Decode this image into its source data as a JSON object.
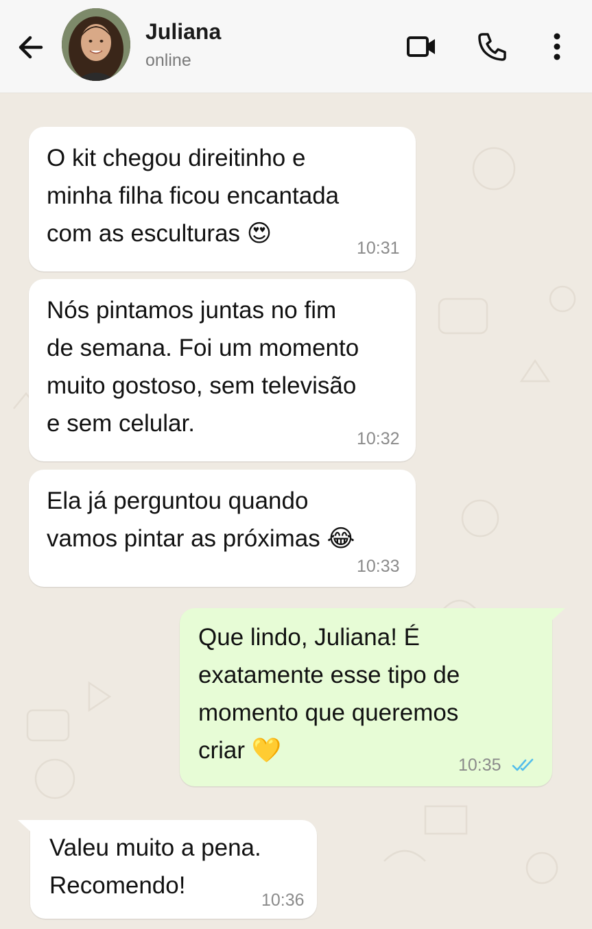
{
  "header": {
    "contact_name": "Juliana",
    "status": "online"
  },
  "messages": [
    {
      "direction": "in",
      "text": "O kit chegou direitinho e\nminha filha ficou encantada\ncom as esculturas 😍",
      "time": "10:31"
    },
    {
      "direction": "in",
      "text": "Nós pintamos juntas no fim\nde semana. Foi um momento\nmuito gostoso, sem televisão\ne sem celular.",
      "time": "10:32"
    },
    {
      "direction": "in",
      "text": "Ela já perguntou quando\nvamos pintar as próximas 😂",
      "time": "10:33"
    },
    {
      "direction": "out",
      "text": "Que lindo, Juliana! É\nexatamente esse tipo de\nmomento que queremos\ncriar 💛",
      "time": "10:35",
      "status": "read"
    },
    {
      "direction": "in",
      "text": "Valeu muito a pena.\nRecomendo!",
      "time": "10:36"
    }
  ],
  "icons": {
    "back": "arrow-left-icon",
    "video": "video-camera-icon",
    "call": "phone-icon",
    "menu": "more-vertical-icon",
    "read_receipt": "double-check-icon"
  },
  "colors": {
    "chat_background": "#efeae2",
    "incoming_bubble": "#ffffff",
    "outgoing_bubble": "#e7fcd6",
    "read_ticks": "#53bdeb"
  }
}
